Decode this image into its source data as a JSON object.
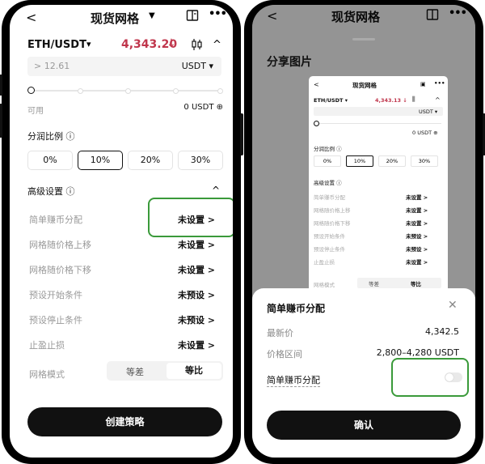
{
  "left": {
    "header": {
      "back": "<",
      "title": "现货网格",
      "title_caret": "▼",
      "book_icon": "book-icon",
      "more": "•••"
    },
    "pair": {
      "name": "ETH/USDT",
      "caret": "▾",
      "price": "4,343.20",
      "price_arrow": "↓",
      "price_color": "#c0364c"
    },
    "amount": {
      "placeholder": "> 12.61",
      "unit": "USDT ▾"
    },
    "slider": {
      "value_fraction": 0
    },
    "available": {
      "label": "可用",
      "value": "0 USDT ⊕"
    },
    "profit_share": {
      "label": "分润比例 ⓘ",
      "options": [
        "0%",
        "10%",
        "20%",
        "30%"
      ],
      "selected": "10%"
    },
    "advanced": {
      "label": "高级设置 ⓘ",
      "toggle": "^"
    },
    "settings": [
      {
        "label": "简单赚币分配",
        "value": "未设置 >"
      },
      {
        "label": "网格随价格上移",
        "value": "未设置 >"
      },
      {
        "label": "网格随价格下移",
        "value": "未设置 >"
      },
      {
        "label": "预设开始条件",
        "value": "未预设 >"
      },
      {
        "label": "预设停止条件",
        "value": "未预设 >"
      },
      {
        "label": "止盈止损",
        "value": "未设置 >"
      }
    ],
    "grid_mode": {
      "label": "网格模式",
      "options": [
        "等差",
        "等比"
      ],
      "selected": "等比"
    },
    "create_button": "创建策略"
  },
  "right": {
    "header": {
      "back": "<",
      "title": "现货网格",
      "book_icon": "book-icon",
      "more": "•••"
    },
    "share_title": "分享图片",
    "mini": {
      "title": "现货网格",
      "pair": "ETH/USDT ▾",
      "price": "4,343.13 ↓",
      "unit": "USDT ▾",
      "available": "0 USDT ⊕",
      "profit_label": "分润比例 ⓘ",
      "chips": [
        "0%",
        "10%",
        "20%",
        "30%"
      ],
      "advanced": "高级设置 ⓘ",
      "rows": [
        {
          "label": "简单赚币分配",
          "value": "未设置 >"
        },
        {
          "label": "网格随价格上移",
          "value": "未设置 >"
        },
        {
          "label": "网格随价格下移",
          "value": "未设置 >"
        },
        {
          "label": "预设开始条件",
          "value": "未预设 >"
        },
        {
          "label": "预设停止条件",
          "value": "未预设 >"
        },
        {
          "label": "止盈止损",
          "value": "未设置 >"
        }
      ],
      "grid_mode": "网格模式",
      "grid_options": [
        "等差",
        "等比"
      ]
    },
    "sheet": {
      "title": "简单赚币分配",
      "close": "✕",
      "latest_price_label": "最新价",
      "latest_price_value": "4,342.5",
      "range_label": "价格区间",
      "range_value": "2,800–4,280 USDT",
      "toggle_label": "简单赚币分配",
      "toggle_on": false,
      "confirm": "确认"
    }
  }
}
